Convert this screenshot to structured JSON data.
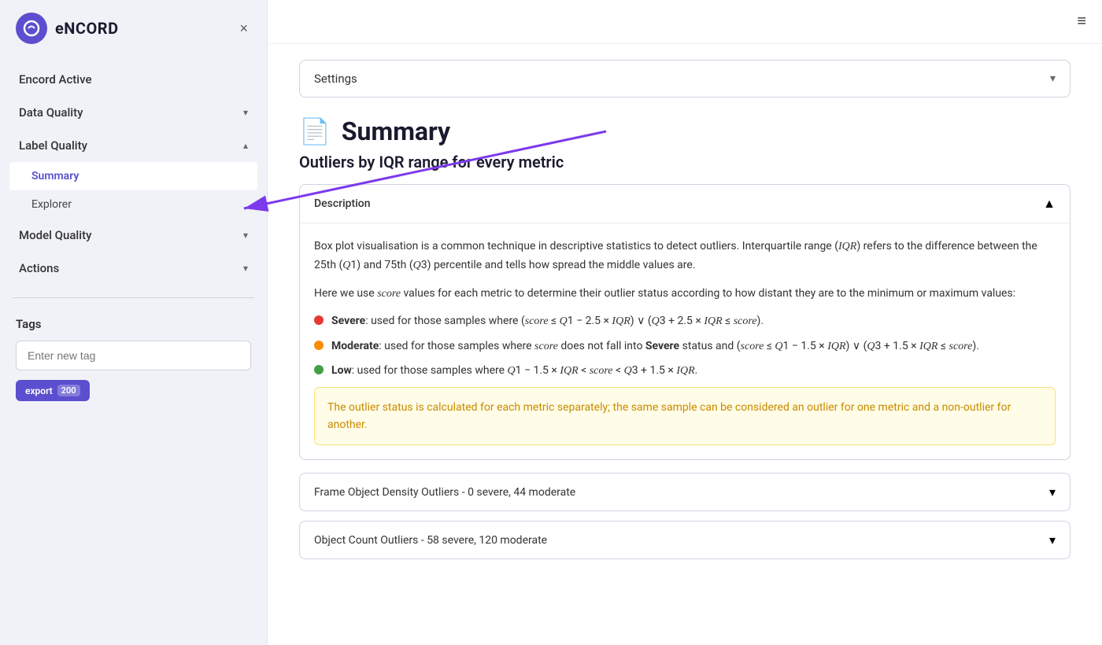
{
  "sidebar": {
    "logo": {
      "symbol": "e",
      "text": "eNCORD"
    },
    "close_label": "×",
    "nav_items": [
      {
        "id": "encord-active",
        "label": "Encord Active",
        "expandable": false
      },
      {
        "id": "data-quality",
        "label": "Data Quality",
        "expandable": true
      },
      {
        "id": "label-quality",
        "label": "Label Quality",
        "expandable": true,
        "expanded": true
      },
      {
        "id": "model-quality",
        "label": "Model Quality",
        "expandable": true
      },
      {
        "id": "actions",
        "label": "Actions",
        "expandable": true
      }
    ],
    "sub_items": [
      {
        "id": "summary",
        "label": "Summary",
        "active": true
      },
      {
        "id": "explorer",
        "label": "Explorer",
        "active": false
      }
    ],
    "tags": {
      "label": "Tags",
      "input_placeholder": "Enter new tag"
    },
    "export_button": {
      "label": "export",
      "count": "200"
    }
  },
  "topbar": {
    "hamburger_icon": "≡"
  },
  "main": {
    "settings_dropdown": {
      "label": "Settings",
      "chevron": "▾"
    },
    "page_title": "Summary",
    "page_icon": "📄",
    "section_title": "Outliers by IQR range for every metric",
    "description": {
      "title": "Description",
      "collapse_icon": "▲",
      "paragraphs": [
        "Box plot visualisation is a common technique in descriptive statistics to detect outliers. Interquartile range (IQR) refers to the difference between the 25th (Q1) and 75th (Q3) percentile and tells how spread the middle values are.",
        "Here we use score values for each metric to determine their outlier status according to how distant they are to the minimum or maximum values:"
      ],
      "outlier_types": [
        {
          "id": "severe",
          "color": "red",
          "label": "Severe",
          "description": ": used for those samples where (score ≤ Q1 − 2.5 × IQR) ∨ (Q3 + 2.5 × IQR ≤ score)."
        },
        {
          "id": "moderate",
          "color": "orange",
          "label": "Moderate",
          "description": ": used for those samples where score does not fall into Severe status and (score ≤ Q1 − 1.5 × IQR) ∨ (Q3 + 1.5 × IQR ≤ score)."
        },
        {
          "id": "low",
          "color": "green",
          "label": "Low",
          "description": ": used for those samples where Q1 − 1.5 × IQR < score < Q3 + 1.5 × IQR."
        }
      ],
      "warning_text": "The outlier status is calculated for each metric separately; the same sample can be considered an outlier for one metric and a non-outlier for another."
    },
    "collapsible_rows": [
      {
        "id": "frame-object-density",
        "label": "Frame Object Density Outliers - 0 severe, 44 moderate",
        "chevron": "▾"
      },
      {
        "id": "object-count",
        "label": "Object Count Outliers - 58 severe, 120 moderate",
        "chevron": "▾"
      }
    ]
  },
  "arrow_annotation": {
    "visible": true
  }
}
